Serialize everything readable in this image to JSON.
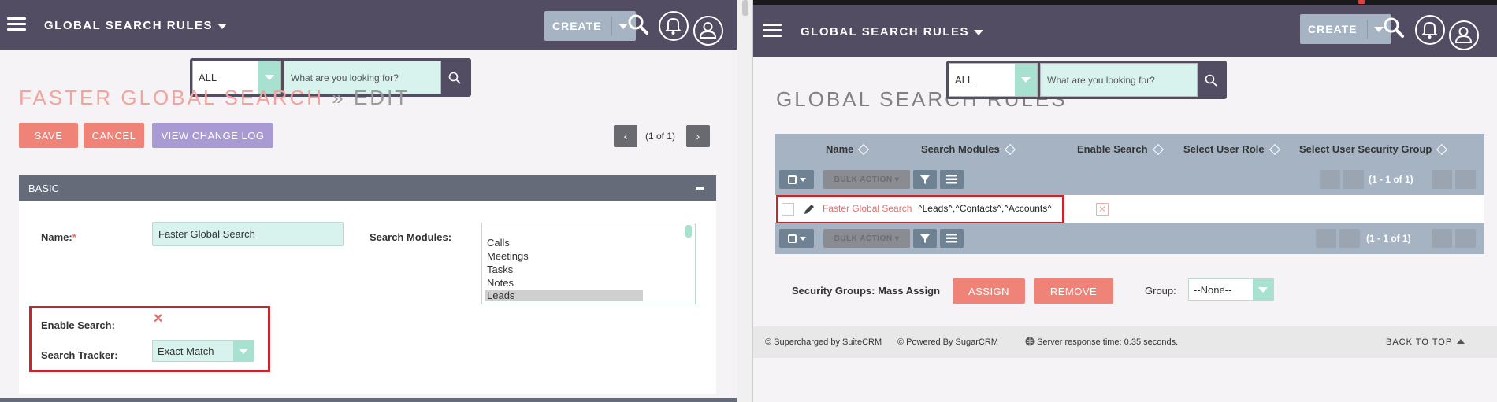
{
  "app": {
    "module_title": "GLOBAL SEARCH RULES",
    "create_label": "CREATE"
  },
  "search": {
    "scope_value": "ALL",
    "placeholder": "What are you looking for?"
  },
  "edit_view": {
    "title_main": "FASTER GLOBAL SEARCH",
    "title_suffix": "» EDIT",
    "save_label": "SAVE",
    "cancel_label": "CANCEL",
    "view_change_log_label": "VIEW CHANGE LOG",
    "pager_text": "(1 of 1)",
    "panel_title": "BASIC",
    "name_label": "Name:",
    "required_mark": "*",
    "name_value": "Faster Global Search",
    "search_modules_label": "Search Modules:",
    "modules_options": [
      "Calls",
      "Meetings",
      "Tasks",
      "Notes",
      "Leads"
    ],
    "modules_selected": "Leads",
    "enable_search_label": "Enable Search:",
    "enable_search_value": "✕",
    "search_tracker_label": "Search Tracker:",
    "search_tracker_value": "Exact Match"
  },
  "list_view": {
    "title": "GLOBAL SEARCH RULES",
    "columns": [
      "Name",
      "Search Modules",
      "Enable Search",
      "Select User Role",
      "Select User Security Group"
    ],
    "bulk_action_label": "BULK ACTION",
    "pager_text": "(1 - 1 of 1)",
    "rows": [
      {
        "name": "Faster Global Search",
        "search_modules": "^Leads^,^Contacts^,^Accounts^",
        "enable_search": "✕"
      }
    ],
    "security_groups_label": "Security Groups: Mass Assign",
    "assign_label": "ASSIGN",
    "remove_label": "REMOVE",
    "group_label": "Group:",
    "group_value": "--None--"
  },
  "footer": {
    "supercharged": "© Supercharged by SuiteCRM",
    "powered": "© Powered By SugarCRM",
    "server_response": "Server response time: 0.35 seconds.",
    "back_to_top": "BACK TO TOP"
  },
  "colors": {
    "topbar": "#534d64",
    "accent_salmon": "#f08377",
    "accent_teal": "#a8e1d0",
    "accent_lilac": "#a99ad3",
    "highlight_red": "#c4262e"
  },
  "icons": {
    "menu": "hamburger-icon",
    "search": "search-icon",
    "notifications": "bell-icon",
    "profile": "user-icon",
    "filter": "filter-icon",
    "columns": "list-icon",
    "edit": "pencil-icon",
    "globe": "globe-icon"
  }
}
